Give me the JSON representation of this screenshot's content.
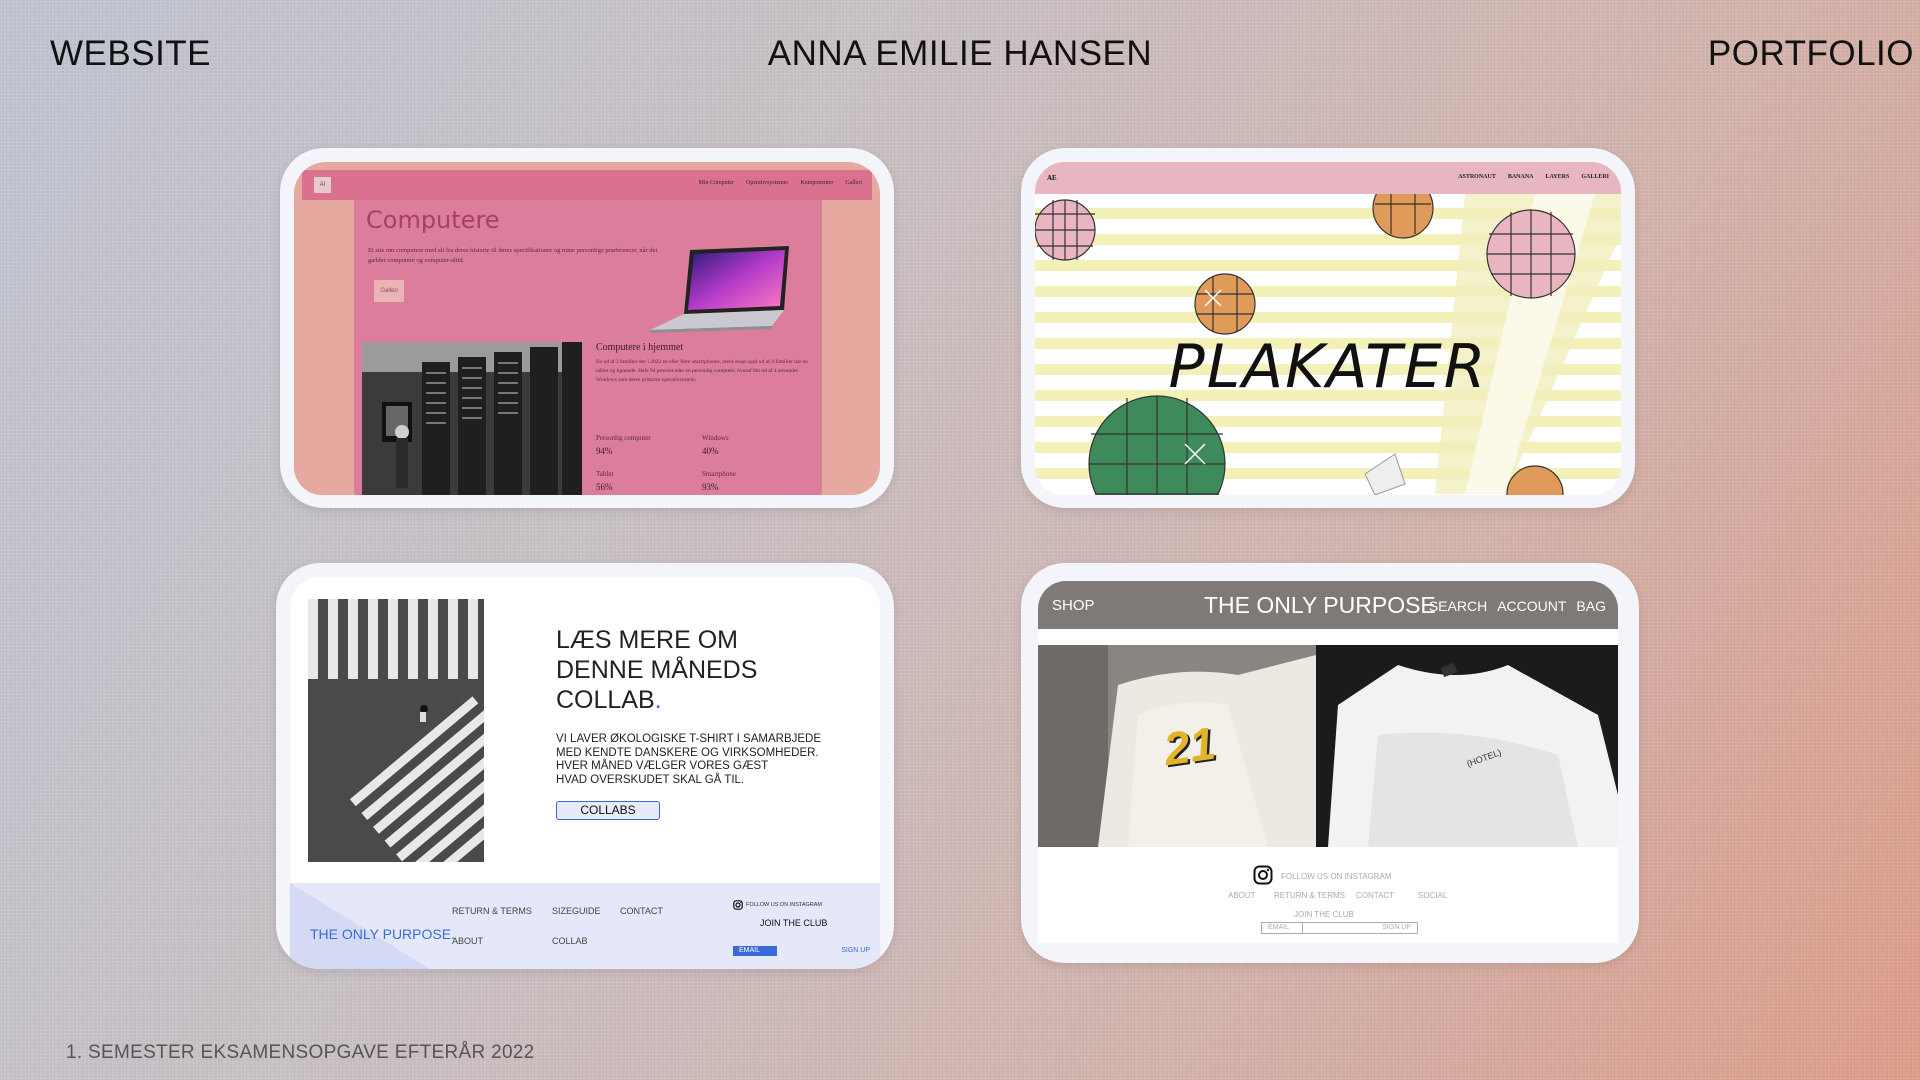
{
  "header": {
    "left": "WEBSITE",
    "center": "ANNA EMILIE HANSEN",
    "right": "PORTFOLIO"
  },
  "footer": {
    "text": "1. SEMESTER EKSAMENSOPGAVE EFTERÅR 2022"
  },
  "colors": {
    "pink_main": "#dc7d9b",
    "pink_nav": "#d9718f",
    "blue_accent": "#3a6ad8",
    "gray_nav": "#7f7a78"
  },
  "computere": {
    "logo": "AI",
    "nav": [
      "Min Computer",
      "Operativsystemer",
      "Komponenter",
      "Galleri"
    ],
    "title": "Computere",
    "intro": "Et site om computere med alt fra deres historie til deres specifikationer og mine personlige præferencer, når det gælder computere og computer-altid.",
    "button": "Galleri",
    "subtitle": "Computere i hjemmet",
    "body": "En ud af 3 familier der i 2022 en eller flere smartphones, mens knap også ud af 4 familier har en tablet og lignende. Hele 94 procent eder en personlig computer, hvoraf 9m ud af 4 anvender Windows som deres primære operativsystem.",
    "stats": [
      {
        "label": "Personlig computer",
        "value": "94%"
      },
      {
        "label": "Windows",
        "value": "40%"
      },
      {
        "label": "Tablet",
        "value": "56%"
      },
      {
        "label": "Smartphone",
        "value": "93%"
      }
    ]
  },
  "plakater": {
    "logo": "AE",
    "nav": [
      "ASTRONAUT",
      "BANANA",
      "LAYERS",
      "GALLERI"
    ],
    "title": "PLAKATER"
  },
  "collab": {
    "heading_line1": "LÆS MERE OM",
    "heading_line2": "DENNE MÅNEDS",
    "heading_line3": "COLLAB",
    "heading_dot": ".",
    "text_line1": "VI LAVER ØKOLOGISKE T-SHIRT I SAMARBJEDE",
    "text_line2": "MED KENDTE DANSKERE OG VIRKSOMHEDER.",
    "text_line3": "HVER MÅNED VÆLGER VORES GÆST",
    "text_line4": "HVAD OVERSKUDET SKAL GÅ TIL.",
    "button": "COLLABS",
    "brand": "THE ONLY PURPOSE.",
    "links": {
      "return": "RETURN & TERMS",
      "size": "SIZEGUIDE",
      "contact": "CONTACT",
      "about": "ABOUT",
      "collab": "COLLAB"
    },
    "instagram": "FOLLOW US ON INSTAGRAM",
    "join": "JOIN THE CLUB",
    "email": "EMAIL",
    "signup": "SIGN UP"
  },
  "shop": {
    "shop": "SHOP",
    "brand": "THE ONLY PURPOSE",
    "links": [
      "SEARCH",
      "ACCOUNT",
      "BAG"
    ],
    "shirt1_print": "21",
    "shirt2_print": "(HOTEL)",
    "instagram": "FOLLOW US ON INSTAGRAM",
    "footer_links": [
      "ABOUT",
      "RETURN & TERMS",
      "CONTACT",
      "SOCIAL"
    ],
    "join": "JOIN THE CLUB",
    "email": "EMAIL",
    "signup": "SIGN UP"
  }
}
